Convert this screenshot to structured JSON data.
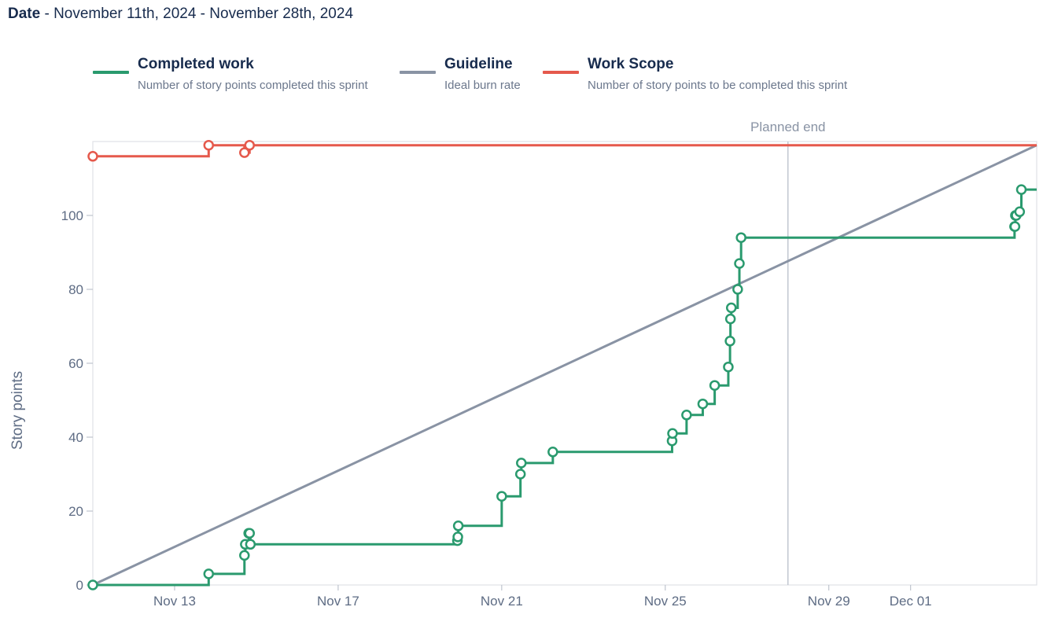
{
  "header": {
    "label": "Date",
    "sep": " - ",
    "range": "November 11th, 2024 - November 28th, 2024"
  },
  "legend": [
    {
      "title": "Completed work",
      "desc": "Number of story points completed this sprint",
      "color": "#2a9a6e"
    },
    {
      "title": "Guideline",
      "desc": "Ideal burn rate",
      "color": "#8993a4"
    },
    {
      "title": "Work Scope",
      "desc": "Number of story points to be completed this sprint",
      "color": "#e5594c"
    }
  ],
  "chart_data": {
    "type": "line",
    "step": true,
    "ylabel": "Story points",
    "y_ticks": [
      0,
      20,
      40,
      60,
      80,
      100
    ],
    "ylim": [
      0,
      120
    ],
    "xlim": [
      "2024-11-11",
      "2024-12-04T02:00"
    ],
    "x_ticks": [
      {
        "date": "2024-11-13",
        "label": "Nov 13"
      },
      {
        "date": "2024-11-17",
        "label": "Nov 17"
      },
      {
        "date": "2024-11-21",
        "label": "Nov 21"
      },
      {
        "date": "2024-11-25",
        "label": "Nov 25"
      },
      {
        "date": "2024-11-29",
        "label": "Nov 29"
      },
      {
        "date": "2024-12-01",
        "label": "Dec 01"
      }
    ],
    "planned_end": {
      "date": "2024-11-28",
      "label": "Planned end"
    },
    "grid": false,
    "legend_position": "top",
    "series": [
      {
        "name": "Work Scope",
        "color": "#e5594c",
        "points": [
          {
            "x": "2024-11-11T00:00",
            "y": 116,
            "marker": true
          },
          {
            "x": "2024-11-13T20:00",
            "y": 119,
            "marker": true
          },
          {
            "x": "2024-11-14T17:00",
            "y": 117,
            "marker": true
          },
          {
            "x": "2024-11-14T20:00",
            "y": 119,
            "marker": true
          },
          {
            "x": "2024-12-04T02:00",
            "y": 119,
            "marker": false
          }
        ]
      },
      {
        "name": "Guideline",
        "color": "#8993a4",
        "points": [
          {
            "x": "2024-11-11T00:00",
            "y": 0,
            "marker": false
          },
          {
            "x": "2024-12-04T02:00",
            "y": 119,
            "marker": false
          }
        ]
      },
      {
        "name": "Completed work",
        "color": "#2a9a6e",
        "points": [
          {
            "x": "2024-11-11T00:00",
            "y": 0,
            "marker": true
          },
          {
            "x": "2024-11-13T20:00",
            "y": 3,
            "marker": true
          },
          {
            "x": "2024-11-14T17:00",
            "y": 8,
            "marker": true
          },
          {
            "x": "2024-11-14T17:30",
            "y": 11,
            "marker": true
          },
          {
            "x": "2024-11-14T19:30",
            "y": 14,
            "marker": true
          },
          {
            "x": "2024-11-14T20:00",
            "y": 14,
            "marker": true
          },
          {
            "x": "2024-11-14T20:30",
            "y": 11,
            "marker": true
          },
          {
            "x": "2024-11-19T22:00",
            "y": 12,
            "marker": true
          },
          {
            "x": "2024-11-19T22:15",
            "y": 13,
            "marker": true
          },
          {
            "x": "2024-11-19T22:30",
            "y": 16,
            "marker": true
          },
          {
            "x": "2024-11-21T00:00",
            "y": 24,
            "marker": true
          },
          {
            "x": "2024-11-21T11:00",
            "y": 30,
            "marker": true
          },
          {
            "x": "2024-11-21T11:30",
            "y": 33,
            "marker": true
          },
          {
            "x": "2024-11-22T06:00",
            "y": 36,
            "marker": true
          },
          {
            "x": "2024-11-25T04:00",
            "y": 39,
            "marker": true
          },
          {
            "x": "2024-11-25T04:15",
            "y": 41,
            "marker": true
          },
          {
            "x": "2024-11-25T12:30",
            "y": 46,
            "marker": true
          },
          {
            "x": "2024-11-25T22:00",
            "y": 49,
            "marker": true
          },
          {
            "x": "2024-11-26T05:00",
            "y": 54,
            "marker": true
          },
          {
            "x": "2024-11-26T13:00",
            "y": 59,
            "marker": true
          },
          {
            "x": "2024-11-26T14:00",
            "y": 66,
            "marker": true
          },
          {
            "x": "2024-11-26T14:15",
            "y": 72,
            "marker": true
          },
          {
            "x": "2024-11-26T14:45",
            "y": 75,
            "marker": true
          },
          {
            "x": "2024-11-26T18:30",
            "y": 80,
            "marker": true
          },
          {
            "x": "2024-11-26T19:30",
            "y": 87,
            "marker": true
          },
          {
            "x": "2024-11-26T20:30",
            "y": 94,
            "marker": true
          },
          {
            "x": "2024-12-03T13:00",
            "y": 97,
            "marker": true
          },
          {
            "x": "2024-12-03T13:15",
            "y": 97,
            "marker": true
          },
          {
            "x": "2024-12-03T13:30",
            "y": 100,
            "marker": true
          },
          {
            "x": "2024-12-03T14:00",
            "y": 100,
            "marker": true
          },
          {
            "x": "2024-12-03T16:00",
            "y": 101,
            "marker": true
          },
          {
            "x": "2024-12-03T17:00",
            "y": 107,
            "marker": true
          },
          {
            "x": "2024-12-04T02:00",
            "y": 107,
            "marker": false
          }
        ]
      }
    ]
  }
}
